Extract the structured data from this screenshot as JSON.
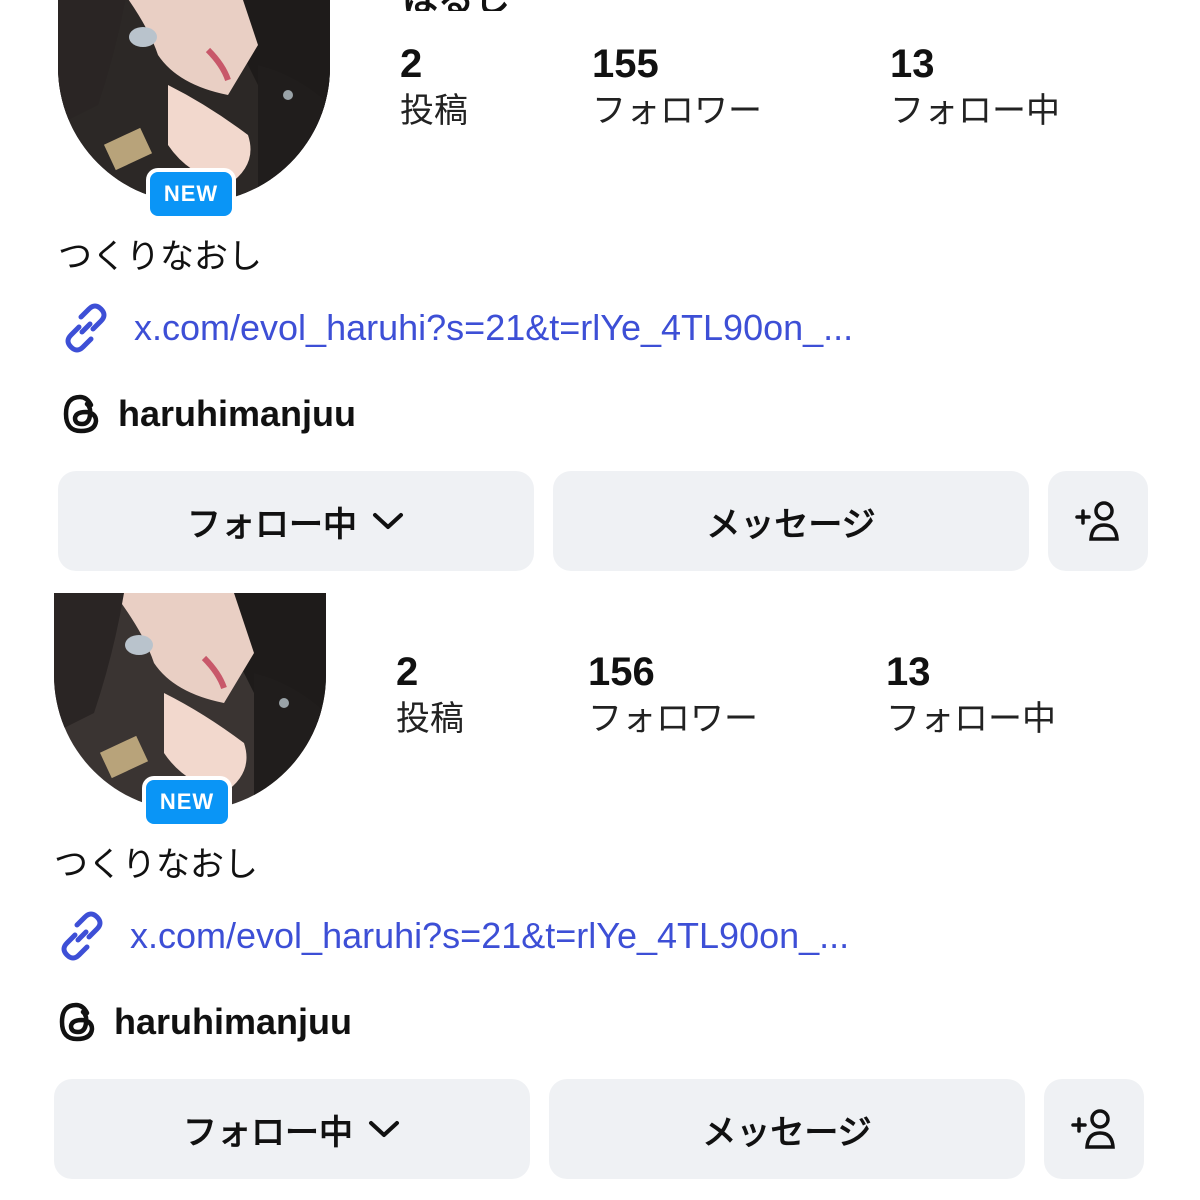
{
  "profiles": [
    {
      "display_name": "はるし",
      "stats": [
        {
          "value": "2",
          "label": "投稿"
        },
        {
          "value": "155",
          "label": "フォロワー"
        },
        {
          "value": "13",
          "label": "フォロー中"
        }
      ],
      "badge": "NEW",
      "bio": "つくりなおし",
      "link": "x.com/evol_haruhi?s=21&t=rlYe_4TL90on_...",
      "threads_handle": "haruhimanjuu",
      "buttons": {
        "follow": "フォロー中",
        "message": "メッセージ"
      }
    },
    {
      "display_name": "",
      "stats": [
        {
          "value": "2",
          "label": "投稿"
        },
        {
          "value": "156",
          "label": "フォロワー"
        },
        {
          "value": "13",
          "label": "フォロー中"
        }
      ],
      "badge": "NEW",
      "bio": "つくりなおし",
      "link": "x.com/evol_haruhi?s=21&t=rlYe_4TL90on_...",
      "threads_handle": "haruhimanjuu",
      "buttons": {
        "follow": "フォロー中",
        "message": "メッセージ"
      }
    }
  ],
  "icons": {
    "link": "link-icon",
    "threads": "threads-icon",
    "dropdown": "chevron-down-icon",
    "add_person": "add-person-icon"
  },
  "colors": {
    "badge_bg": "#0a95f6",
    "link": "#3d4fd6",
    "button_bg": "#eff1f4"
  }
}
